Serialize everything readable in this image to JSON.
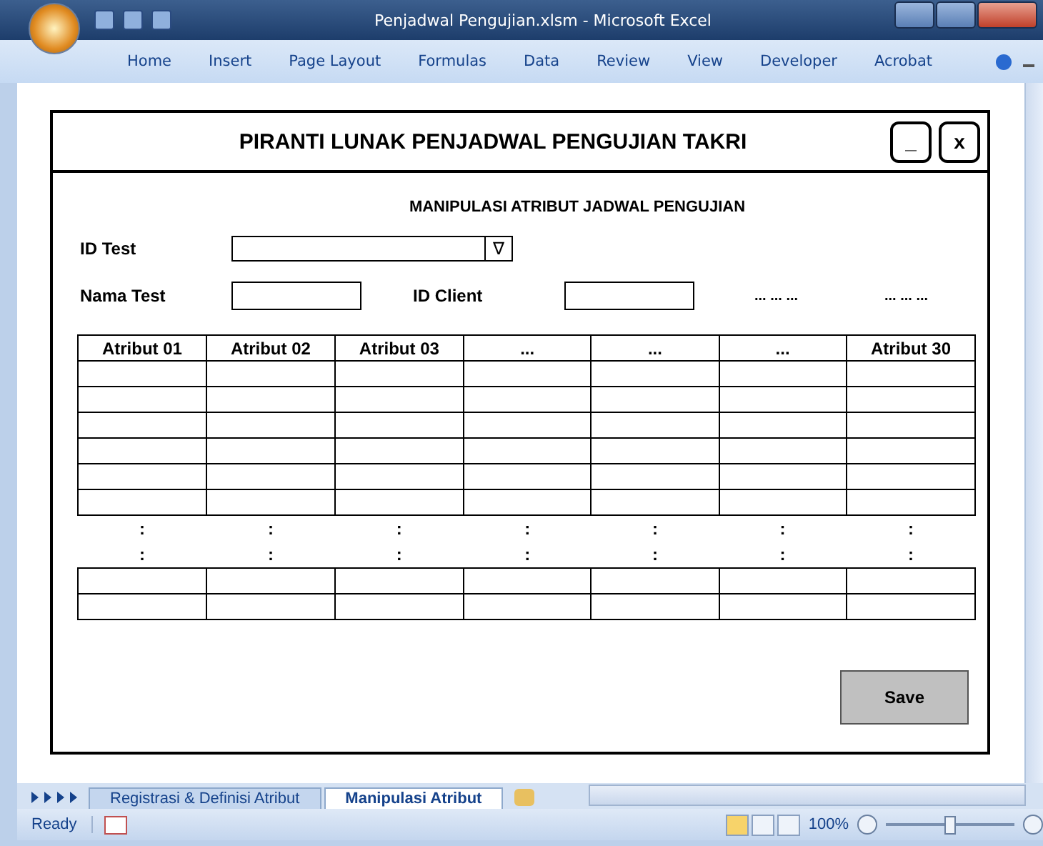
{
  "window": {
    "title": "Penjadwal Pengujian.xlsm - Microsoft Excel"
  },
  "ribbon": {
    "tabs": [
      "Home",
      "Insert",
      "Page Layout",
      "Formulas",
      "Data",
      "Review",
      "View",
      "Developer",
      "Acrobat"
    ]
  },
  "form": {
    "title": "PIRANTI LUNAK PENJADWAL PENGUJIAN TAKRI",
    "minimize": "_",
    "close": "x",
    "subtitle": "MANIPULASI ATRIBUT JADWAL PENGUJIAN",
    "id_test": {
      "label": "ID Test",
      "arrow": "∇"
    },
    "nama_test": {
      "label": "Nama Test"
    },
    "id_client": {
      "label": "ID Client"
    },
    "more": [
      "... ... ...",
      "... ... ..."
    ],
    "table": {
      "columns": [
        "Atribut 01",
        "Atribut 02",
        "Atribut 03",
        "...",
        "...",
        "...",
        "Atribut 30"
      ],
      "rows": [
        {
          "kind": "blank"
        },
        {
          "kind": "blank"
        },
        {
          "kind": "blank"
        },
        {
          "kind": "blank"
        },
        {
          "kind": "blank"
        },
        {
          "kind": "blank"
        },
        {
          "kind": "continuation",
          "cells": [
            ":",
            ":",
            ":",
            ":",
            ":",
            ":",
            ":"
          ]
        },
        {
          "kind": "continuation",
          "cells": [
            ":",
            ":",
            ":",
            ":",
            ":",
            ":",
            ":"
          ]
        },
        {
          "kind": "blank"
        },
        {
          "kind": "blank"
        }
      ]
    },
    "save": "Save"
  },
  "sheet_tabs": [
    {
      "label": "Registrasi & Definisi Atribut",
      "selected": false
    },
    {
      "label": "Manipulasi Atribut",
      "selected": true
    }
  ],
  "status_bar": {
    "status": "Ready",
    "zoom": "100%",
    "zoom_slider": {
      "level": 0.5
    }
  }
}
